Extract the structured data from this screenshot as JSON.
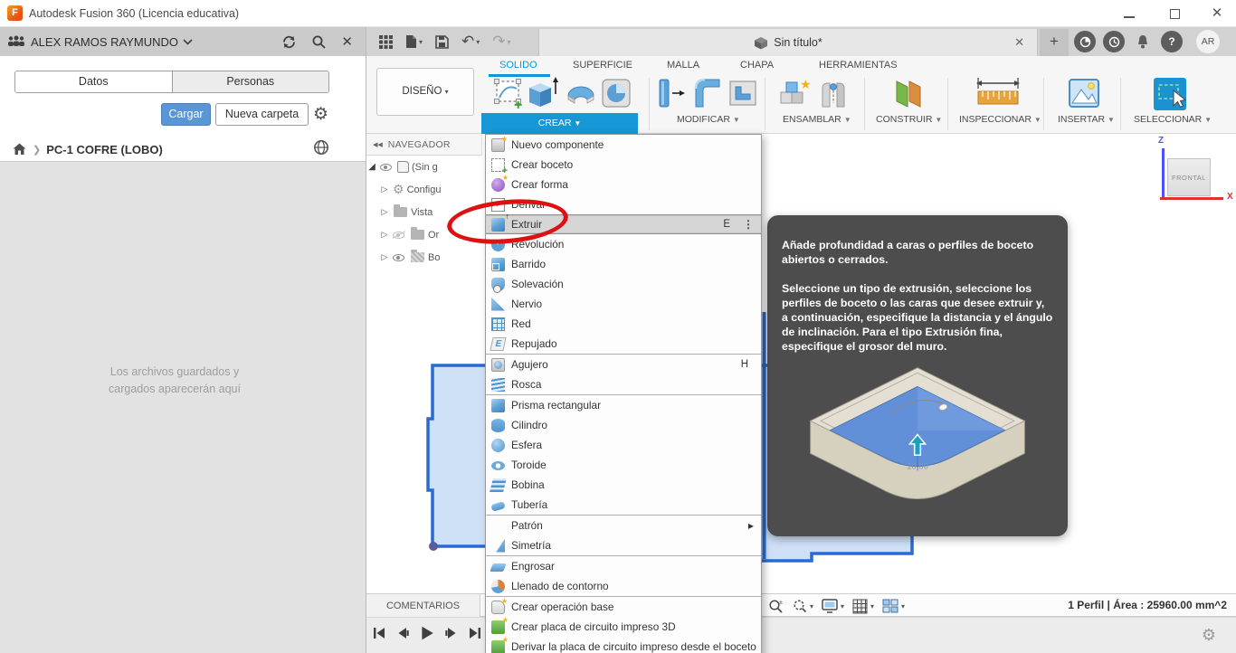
{
  "window": {
    "title": "Autodesk Fusion 360 (Licencia educativa)",
    "controls": [
      "minimize-icon",
      "maximize-icon",
      "close-icon"
    ]
  },
  "left_panel": {
    "user": "ALEX RAMOS RAYMUNDO",
    "header_icons": [
      "people-icon",
      "refresh-icon",
      "search-icon",
      "close-icon"
    ],
    "tabs": [
      {
        "label": "Datos",
        "active": true
      },
      {
        "label": "Personas",
        "active": false
      }
    ],
    "upload_button": "Cargar",
    "new_folder_button": "Nueva carpeta",
    "breadcrumb": {
      "home_icon": "home-icon",
      "project": "PC-1 COFRE (LOBO)",
      "right_icon": "globe-icon"
    },
    "empty_message_line1": "Los archivos guardados y",
    "empty_message_line2": "cargados aparecerán aquí"
  },
  "appbar": {
    "icons": [
      "app-grid-icon",
      "file-icon",
      "save-icon",
      "undo-icon",
      "redo-icon"
    ],
    "document_tab": {
      "title": "Sin título*",
      "icon": "cube-icon",
      "close_icon": "close-icon"
    },
    "new_tab_label": "+",
    "right_icons": [
      "extensions-icon",
      "clock-icon",
      "bell-icon",
      "help-icon"
    ],
    "avatar": "AR"
  },
  "toolbar": {
    "workspace": "DISEÑO",
    "tabs": [
      {
        "label": "SOLIDO",
        "active": true
      },
      {
        "label": "SUPERFICIE",
        "active": false
      },
      {
        "label": "MALLA",
        "active": false
      },
      {
        "label": "CHAPA",
        "active": false
      },
      {
        "label": "HERRAMIENTAS",
        "active": false
      }
    ],
    "groups": [
      {
        "label": "CREAR",
        "highlighted": true,
        "icons": [
          "create-sketch-icon",
          "extrude-icon",
          "revolve-icon",
          "hole-icon"
        ]
      },
      {
        "label": "MODIFICAR",
        "highlighted": false,
        "icons": [
          "press-pull-icon",
          "fillet-icon",
          "shell-icon"
        ]
      },
      {
        "label": "ENSAMBLAR",
        "highlighted": false,
        "icons": [
          "new-component-icon",
          "joint-icon"
        ]
      },
      {
        "label": "CONSTRUIR",
        "highlighted": false,
        "icons": [
          "construction-plane-icon"
        ]
      },
      {
        "label": "INSPECCIONAR",
        "highlighted": false,
        "icons": [
          "measure-icon"
        ]
      },
      {
        "label": "INSERTAR",
        "highlighted": false,
        "icons": [
          "insert-image-icon"
        ]
      },
      {
        "label": "SELECCIONAR",
        "highlighted": false,
        "icons": [
          "select-icon"
        ]
      }
    ]
  },
  "navigator": {
    "title": "NAVEGADOR",
    "collapse_icon": "collapse-left-icon",
    "root_label": "(Sin g",
    "items": [
      {
        "label": "Configu",
        "icon": "gear-icon",
        "eye": "none"
      },
      {
        "label": "Vista",
        "icon": "folder-icon",
        "eye": "none"
      },
      {
        "label": "Or",
        "icon": "folder-icon",
        "eye": "hidden"
      },
      {
        "label": "Bo",
        "icon": "sketch-folder-icon",
        "eye": "visible"
      }
    ]
  },
  "create_menu": {
    "items": [
      {
        "label": "Nuevo componente",
        "icon": "nuevo-componente"
      },
      {
        "label": "Crear boceto",
        "icon": "crear-boceto"
      },
      {
        "label": "Crear forma",
        "icon": "crear-forma"
      },
      {
        "label": "Derivar",
        "icon": "derivar"
      },
      {
        "label": "Extruir",
        "icon": "extruir",
        "shortcut": "E",
        "highlighted": true,
        "more": true
      },
      {
        "label": "Revolución",
        "icon": "revolucion"
      },
      {
        "label": "Barrido",
        "icon": "barrido"
      },
      {
        "label": "Solevación",
        "icon": "solevacion"
      },
      {
        "label": "Nervio",
        "icon": "nervio"
      },
      {
        "label": "Red",
        "icon": "red"
      },
      {
        "label": "Repujado",
        "icon": "repujado",
        "divider_after": true
      },
      {
        "label": "Agujero",
        "icon": "agujero",
        "shortcut": "H"
      },
      {
        "label": "Rosca",
        "icon": "rosca",
        "divider_after": true
      },
      {
        "label": "Prisma rectangular",
        "icon": "prisma"
      },
      {
        "label": "Cilindro",
        "icon": "cilindro"
      },
      {
        "label": "Esfera",
        "icon": "esfera"
      },
      {
        "label": "Toroide",
        "icon": "toroide"
      },
      {
        "label": "Bobina",
        "icon": "bobina"
      },
      {
        "label": "Tubería",
        "icon": "tuberia",
        "divider_after": true
      },
      {
        "label": "Patrón",
        "icon": "none",
        "submenu": true
      },
      {
        "label": "Simetría",
        "icon": "simetria",
        "divider_after": true
      },
      {
        "label": "Engrosar",
        "icon": "engrosar"
      },
      {
        "label": "Llenado de contorno",
        "icon": "llenado",
        "divider_after": true
      },
      {
        "label": "Crear operación base",
        "icon": "operacion-base"
      },
      {
        "label": "Crear placa de circuito impreso 3D",
        "icon": "placa-3d"
      },
      {
        "label": "Derivar la placa de circuito impreso desde el boceto",
        "icon": "derivar-placa"
      }
    ]
  },
  "tooltip": {
    "paragraph1": "Añade profundidad a caras o perfiles de boceto abiertos o cerrados.",
    "paragraph2": "Seleccione un tipo de extrusión, seleccione los perfiles de boceto o las caras que desee extruir y, a continuación, especifique la distancia y el ángulo de inclinación. Para el tipo Extrusión fina, especifique el grosor del muro.",
    "illustration_dimension": "10.00"
  },
  "viewcube": {
    "face": "FRONTAL",
    "axis_z": "Z",
    "axis_x": "X"
  },
  "status_bar": {
    "comments_label": "COMENTARIOS",
    "display_tools": [
      "zoom-icon",
      "zoom-window-icon",
      "display-settings-icon",
      "grid-icon",
      "viewports-icon"
    ],
    "selection_info": "1 Perfil | Área : 25960.00 mm^2"
  },
  "timeline": {
    "controls": [
      "skip-start-icon",
      "step-back-icon",
      "play-icon",
      "step-forward-icon",
      "skip-end-icon"
    ],
    "gear_icon": "gear-icon"
  },
  "colors": {
    "accent_blue": "#0a99d6",
    "menu_highlight": "#d6d6d6",
    "tooltip_background": "#4d4d4d",
    "annotation_red": "#dd1111",
    "sketch_fill": "#cfe1f7",
    "sketch_stroke": "#2a6bd2",
    "upload_button_blue": "#5a96d5"
  }
}
